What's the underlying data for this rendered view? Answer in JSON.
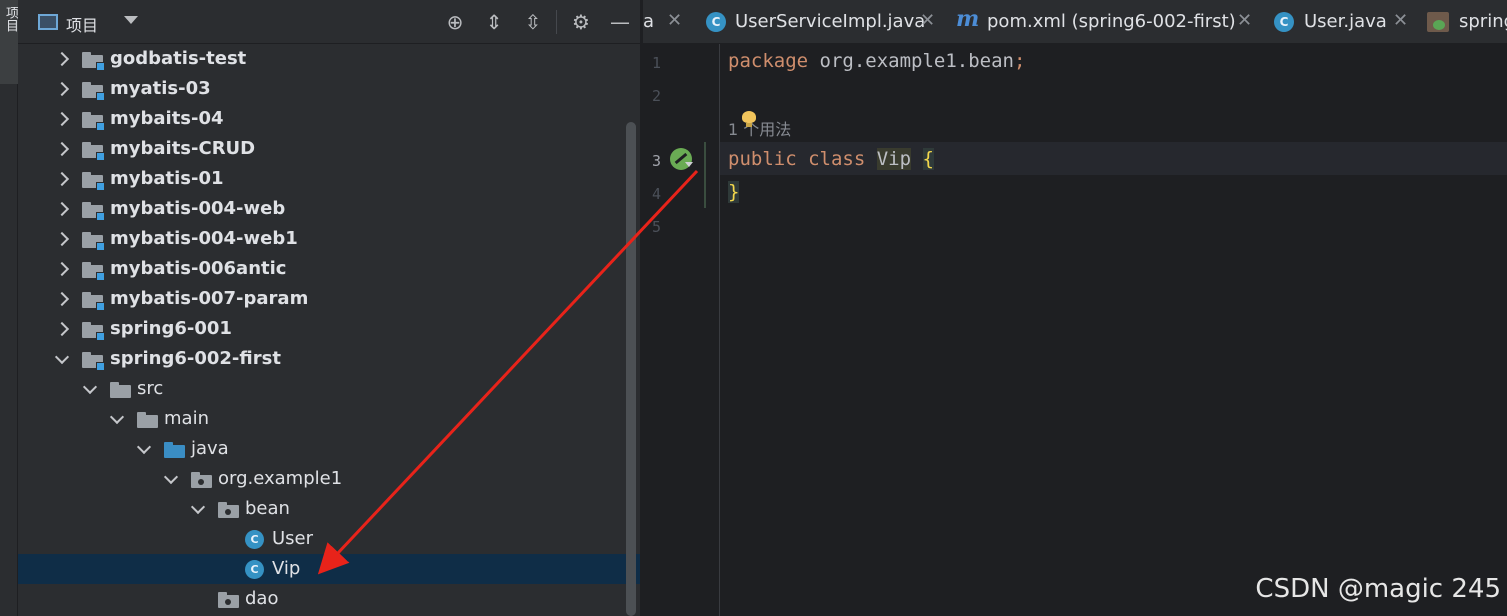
{
  "tool_strip": {
    "project_label": "项目"
  },
  "project_panel": {
    "title": "项目",
    "items": [
      {
        "label": "godbatis-test",
        "kind": "module",
        "expanded": false
      },
      {
        "label": "myatis-03",
        "kind": "module",
        "expanded": false
      },
      {
        "label": "mybaits-04",
        "kind": "module",
        "expanded": false
      },
      {
        "label": "mybaits-CRUD",
        "kind": "module",
        "expanded": false
      },
      {
        "label": "mybatis-01",
        "kind": "module",
        "expanded": false
      },
      {
        "label": "mybatis-004-web",
        "kind": "module",
        "expanded": false
      },
      {
        "label": "mybatis-004-web1",
        "kind": "module",
        "expanded": false
      },
      {
        "label": "mybatis-006antic",
        "kind": "module",
        "expanded": false
      },
      {
        "label": "mybatis-007-param",
        "kind": "module",
        "expanded": false
      },
      {
        "label": "spring6-001",
        "kind": "module",
        "expanded": false
      },
      {
        "label": "spring6-002-first",
        "kind": "module",
        "expanded": true
      },
      {
        "label": "src",
        "kind": "folder",
        "expanded": true
      },
      {
        "label": "main",
        "kind": "folder",
        "expanded": true
      },
      {
        "label": "java",
        "kind": "source-folder",
        "expanded": true
      },
      {
        "label": "org.example1",
        "kind": "package",
        "expanded": true
      },
      {
        "label": "bean",
        "kind": "package",
        "expanded": true
      },
      {
        "label": "User",
        "kind": "class",
        "class_glyph": "C"
      },
      {
        "label": "Vip",
        "kind": "class",
        "class_glyph": "C",
        "selected": true
      },
      {
        "label": "dao",
        "kind": "package"
      }
    ]
  },
  "tabs": [
    {
      "label": "a",
      "kind": "partial"
    },
    {
      "label": "UserServiceImpl.java",
      "kind": "class",
      "glyph": "C"
    },
    {
      "label": "pom.xml (spring6-002-first)",
      "kind": "maven",
      "glyph": "m"
    },
    {
      "label": "User.java",
      "kind": "class",
      "glyph": "C"
    },
    {
      "label": "spring",
      "kind": "spring"
    }
  ],
  "tab_close_glyph": "✕",
  "editor": {
    "line_numbers": [
      "1",
      "2",
      "3",
      "4",
      "5"
    ],
    "line1": {
      "kw": "package",
      "text": " org.example1.bean",
      "semi": ";"
    },
    "usage_hint": "1 个用法",
    "line3": {
      "kw": "public class",
      "name": "Vip",
      "brace": "{"
    },
    "line4": {
      "brace": "}"
    }
  },
  "watermark": "CSDN @magic 245",
  "colors": {
    "keyword": "#cf8e6d",
    "selection": "#0f2d47",
    "class_icon": "#3592c4",
    "arrow": "#e8231a"
  }
}
